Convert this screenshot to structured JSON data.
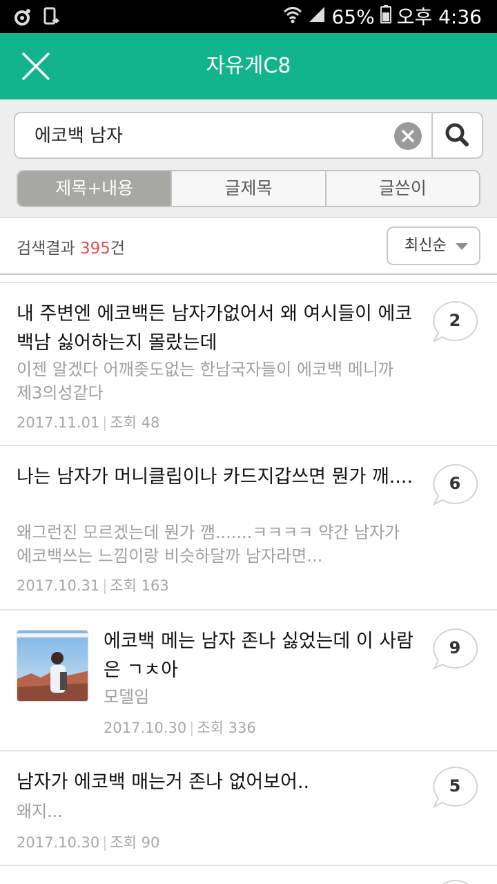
{
  "status_bar": {
    "battery": "65%",
    "time": "오후 4:36",
    "icons": [
      "notification-icon",
      "screen-rotate-icon",
      "wifi-icon",
      "signal-icon",
      "battery-icon"
    ]
  },
  "app_bar": {
    "title": "자유게C8",
    "close_icon": "close-icon"
  },
  "search": {
    "query": "에코백 남자",
    "tabs": [
      "제목+내용",
      "글제목",
      "글쓴이"
    ],
    "selected_tab": "제목+내용"
  },
  "results": {
    "label": "검색결과",
    "count": "395",
    "unit": "건",
    "sort": "최신순"
  },
  "posts": [
    {
      "title": "내 주변엔 에코백든 남자가없어서 왜 여시들이 에코백남 싫어하는지 몰랐는데",
      "body": "이젠 알겠다 어깨좆도없는 한남국자들이 에코백 메니까 제3의성같다",
      "date": "2017.11.01",
      "views_label": "조회",
      "views": "48",
      "comments": "2"
    },
    {
      "title": "나는 남자가 머니클립이나 카드지갑쓰면 뭔가 깨....",
      "body": "왜그런진 모르겠는데 뭔가 깸.......ㅋㅋㅋㅋ 약간 남자가 에코백쓰는 느낌이랑 비슷하달까 남자라면...",
      "date": "2017.10.31",
      "views_label": "조회",
      "views": "163",
      "comments": "6"
    },
    {
      "title": "에코백 메는 남자 존나 싫었는데 이 사람은 ㄱㅊ아",
      "body": "모델임",
      "date": "2017.10.30",
      "views_label": "조회",
      "views": "336",
      "comments": "9",
      "has_thumbnail": true
    },
    {
      "title": "남자가 에코백 매는거 존나 없어보어..",
      "body": "왜지...",
      "date": "2017.10.30",
      "views_label": "조회",
      "views": "90",
      "comments": "5"
    }
  ],
  "colors": {
    "accent": "#12b48e",
    "count_highlight": "#e2504d",
    "selected_tab": "#a7a7a4"
  }
}
